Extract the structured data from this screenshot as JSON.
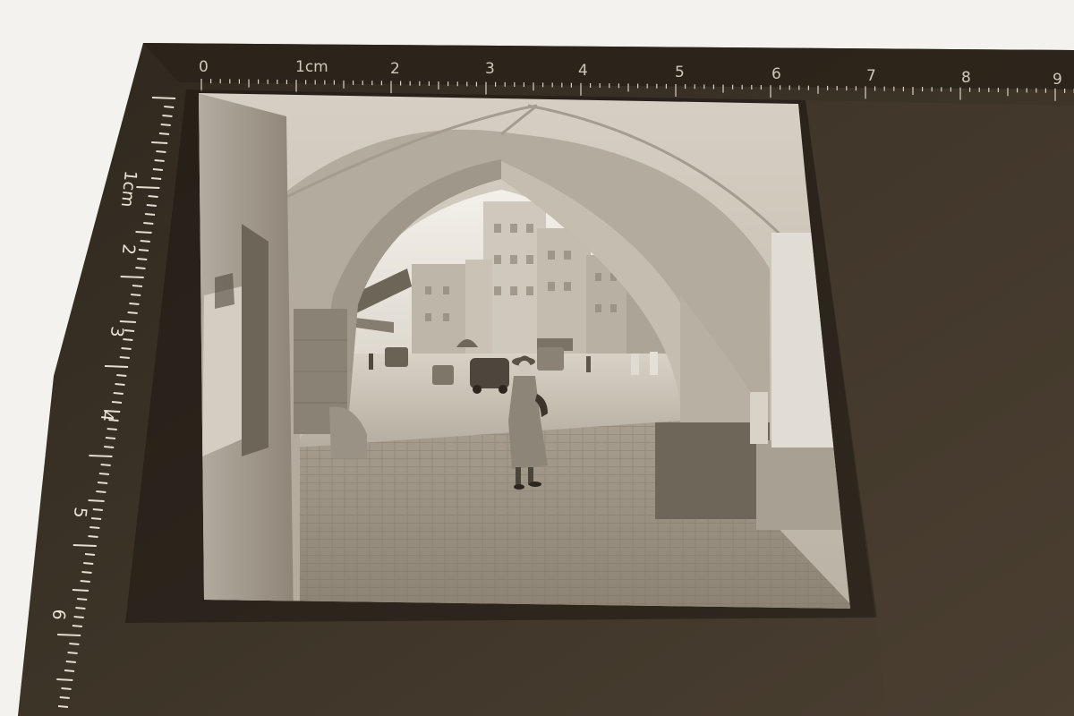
{
  "image": {
    "subject": "film-negative-contact-print",
    "colors": {
      "paper": "#f4f2ee",
      "film_base": "#3b3327",
      "film_dark": "#2a231a",
      "sepia_light": "#e9e4dc",
      "sepia_mid": "#a39a8c",
      "sepia_dark": "#5c5448"
    }
  },
  "ruler": {
    "top": {
      "unit_label": "1cm",
      "numbers": [
        "0",
        "1cm",
        "2",
        "3",
        "4",
        "5",
        "6",
        "7",
        "8",
        "9"
      ]
    },
    "left": {
      "unit_label": "1cm",
      "numbers": [
        "1cm",
        "2",
        "3",
        "4",
        "5",
        "6"
      ]
    }
  }
}
